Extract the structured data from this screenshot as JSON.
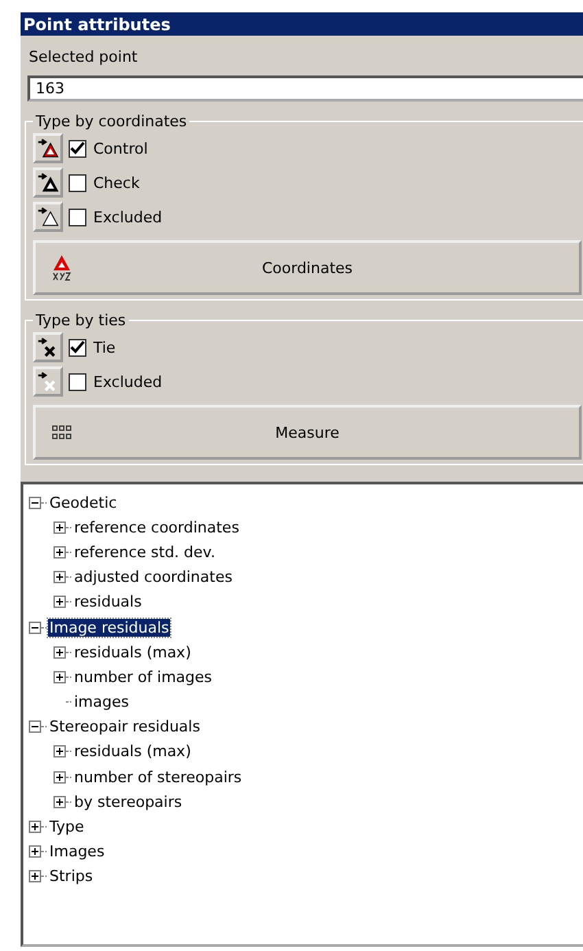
{
  "window": {
    "title": "Point attributes"
  },
  "selected_point": {
    "label": "Selected point",
    "value": "163"
  },
  "coordinate_group": {
    "title": "Type by coordinates",
    "rows": [
      {
        "kind": "control",
        "label": "Control",
        "checked": true
      },
      {
        "kind": "check",
        "label": "Check",
        "checked": false
      },
      {
        "kind": "excluded",
        "label": "Excluded",
        "checked": false
      }
    ],
    "button": {
      "kind": "coordinates",
      "label": "Coordinates"
    }
  },
  "tie_group": {
    "title": "Type by ties",
    "rows": [
      {
        "kind": "tie",
        "label": "Tie",
        "checked": true
      },
      {
        "kind": "tie_excluded",
        "label": "Excluded",
        "checked": false
      }
    ],
    "button": {
      "kind": "measure",
      "label": "Measure"
    }
  },
  "tree": [
    {
      "label": "Geodetic",
      "expanded": true,
      "selected": false,
      "children": [
        {
          "label": "reference coordinates",
          "expanded": false,
          "selected": false
        },
        {
          "label": "reference std. dev.",
          "expanded": false,
          "selected": false
        },
        {
          "label": "adjusted coordinates",
          "expanded": false,
          "selected": false
        },
        {
          "label": "residuals",
          "expanded": false,
          "selected": false
        }
      ]
    },
    {
      "label": "Image residuals",
      "expanded": true,
      "selected": true,
      "children": [
        {
          "label": "residuals (max)",
          "expanded": false,
          "selected": false
        },
        {
          "label": "number of images",
          "expanded": false,
          "selected": false
        },
        {
          "label": "images",
          "selected": false
        }
      ]
    },
    {
      "label": "Stereopair residuals",
      "expanded": true,
      "selected": false,
      "children": [
        {
          "label": "residuals (max)",
          "expanded": false,
          "selected": false
        },
        {
          "label": "number of stereopairs",
          "expanded": false,
          "selected": false
        },
        {
          "label": "by stereopairs",
          "expanded": false,
          "selected": false
        }
      ]
    },
    {
      "label": "Type",
      "expanded": false,
      "selected": false
    },
    {
      "label": "Images",
      "expanded": false,
      "selected": false
    },
    {
      "label": "Strips",
      "expanded": false,
      "selected": false
    }
  ]
}
